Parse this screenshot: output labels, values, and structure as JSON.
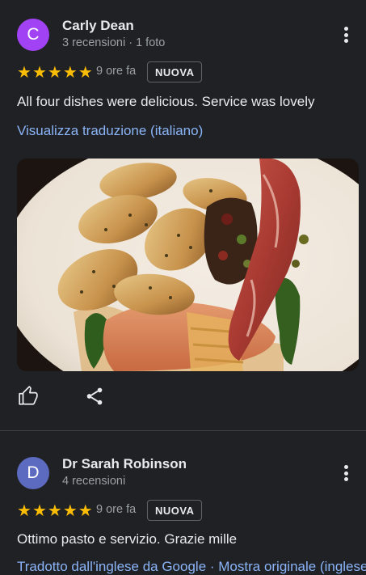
{
  "reviews": [
    {
      "avatar_letter": "C",
      "avatar_color": "#a142f4",
      "name": "Carly Dean",
      "meta": "3 recensioni · 1 foto",
      "stars": [
        "★",
        "★",
        "★",
        "★",
        "★"
      ],
      "rating": 5,
      "time": "9 ore fa",
      "badge": "NUOVA",
      "text": "All four dishes were delicious. Service was lovely",
      "translate_link": "Visualizza traduzione (italiano)"
    },
    {
      "avatar_letter": "D",
      "avatar_color": "#5c6bc0",
      "name": "Dr Sarah Robinson",
      "meta": "4 recensioni",
      "stars": [
        "★",
        "★",
        "★",
        "★",
        "★"
      ],
      "rating": 5,
      "time": "9 ore fa",
      "badge": "NUOVA",
      "text": "Ottimo pasto e servizio. Grazie mille",
      "partial_text": "Tradotto dall'inglese da Google · Mostra originale (inglese)"
    }
  ],
  "colors": {
    "background": "#202124",
    "star": "#fbbc04",
    "link": "#8ab4f8",
    "text": "#e8eaed",
    "secondary_text": "#9aa0a6"
  },
  "icons": {
    "like": "thumb-up-icon",
    "share": "share-icon",
    "more": "more-vert-icon"
  }
}
